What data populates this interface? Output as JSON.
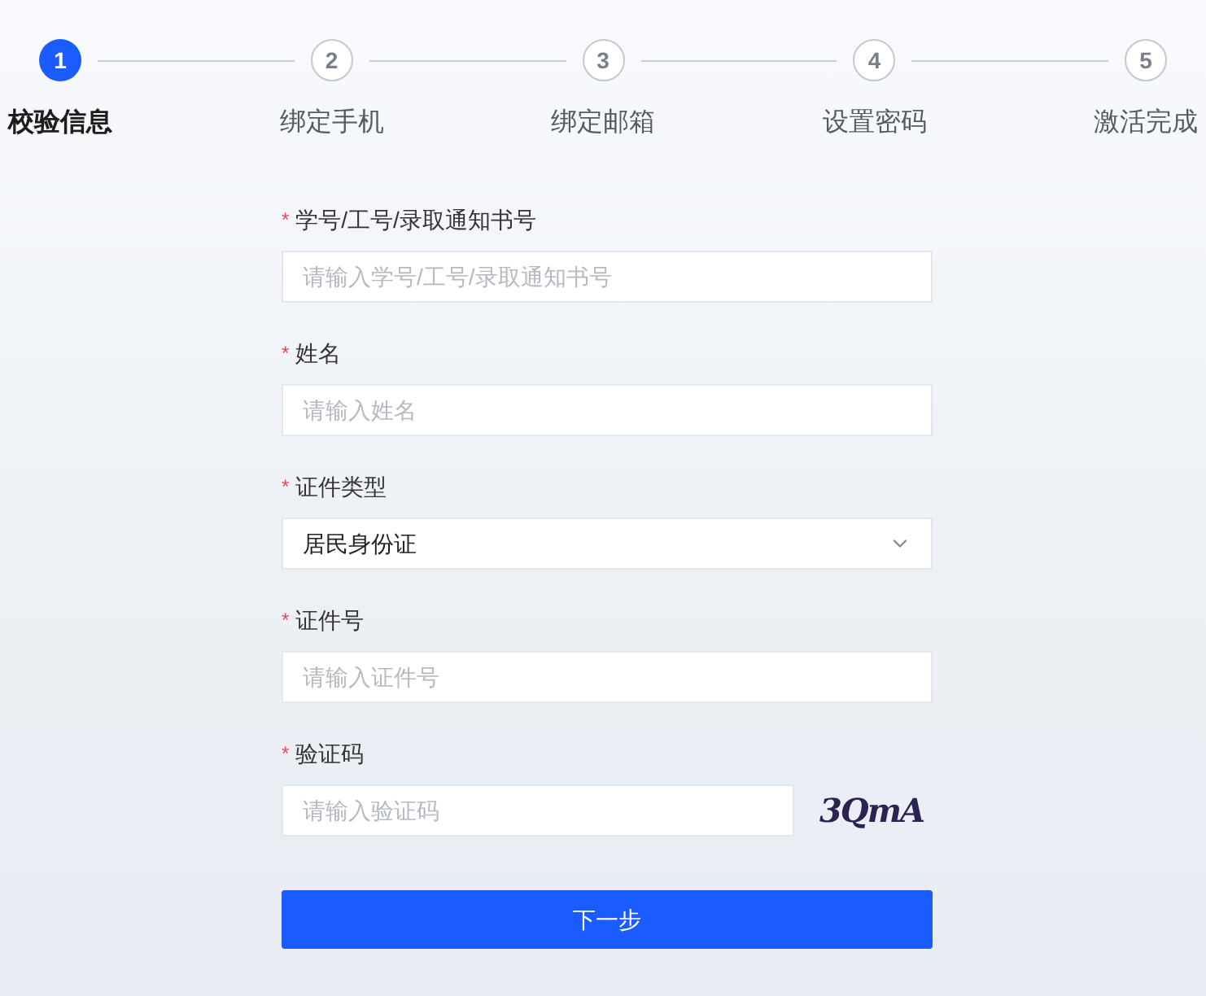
{
  "steps": [
    {
      "number": "1",
      "label": "校验信息",
      "selected": true
    },
    {
      "number": "2",
      "label": "绑定手机",
      "selected": false
    },
    {
      "number": "3",
      "label": "绑定邮箱",
      "selected": false
    },
    {
      "number": "4",
      "label": "设置密码",
      "selected": false
    },
    {
      "number": "5",
      "label": "激活完成",
      "selected": false
    }
  ],
  "form": {
    "fields": [
      {
        "kind": "input",
        "required_mark": "*",
        "label": "学号/工号/录取通知书号",
        "placeholder": "请输入学号/工号/录取通知书号"
      },
      {
        "kind": "input",
        "required_mark": "*",
        "label": "姓名",
        "placeholder": "请输入姓名"
      },
      {
        "kind": "select",
        "required_mark": "*",
        "label": "证件类型",
        "value": "居民身份证"
      },
      {
        "kind": "input",
        "required_mark": "*",
        "label": "证件号",
        "placeholder": "请输入证件号"
      },
      {
        "kind": "captcha",
        "required_mark": "*",
        "label": "验证码",
        "placeholder": "请输入验证码",
        "captcha_text": "3QmA"
      }
    ],
    "submit": "下一步"
  }
}
